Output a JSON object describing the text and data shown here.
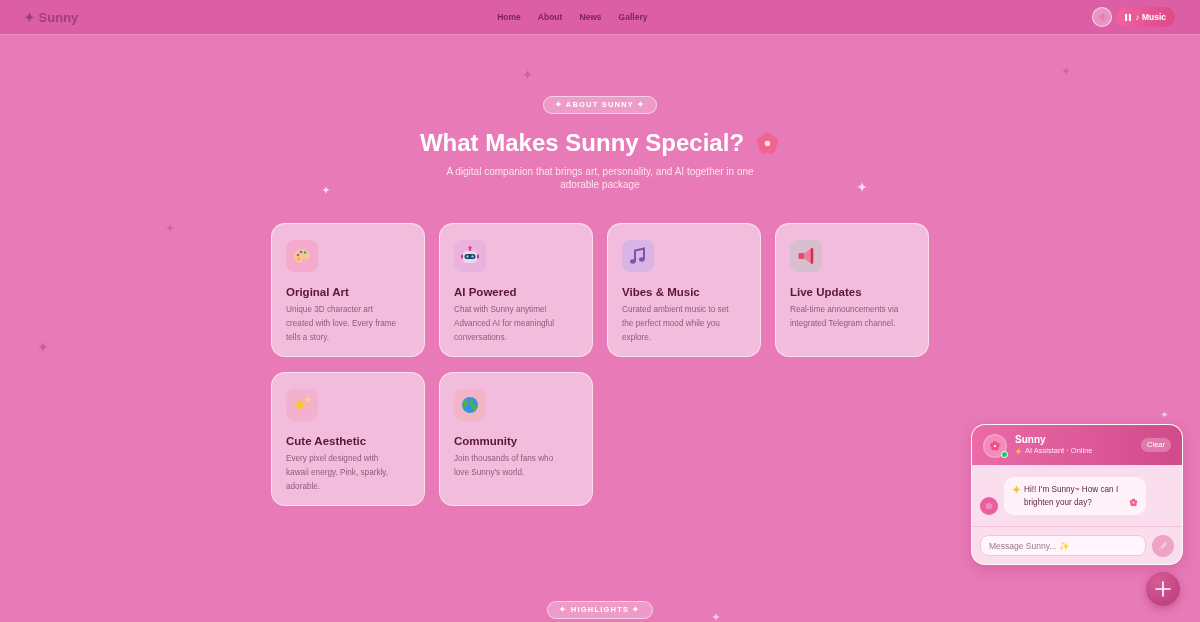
{
  "header": {
    "logo": "✦ Sunny",
    "nav": [
      "Home",
      "About",
      "News",
      "Gallery"
    ],
    "music_button": {
      "label": "♪ Music",
      "playing": true
    }
  },
  "about": {
    "badge": "✦ ABOUT SUNNY ✦",
    "title": "What Makes Sunny Special?",
    "subtitle": "A digital companion that brings art, personality, and AI together in one adorable package"
  },
  "features": [
    {
      "kind": "palette",
      "title": "Original Art",
      "description": "Unique 3D character art created with love. Every frame tells a story."
    },
    {
      "kind": "robot",
      "title": "AI Powered",
      "description": "Chat with Sunny anytime! Advanced AI for meaningful conversations."
    },
    {
      "kind": "music",
      "title": "Vibes & Music",
      "description": "Curated ambient music to set the perfect mood while you explore."
    },
    {
      "kind": "megaphone",
      "title": "Live Updates",
      "description": "Real-time announcements via integrated Telegram channel."
    },
    {
      "kind": "sparkles",
      "title": "Cute Aesthetic",
      "description": "Every pixel designed with kawaii energy. Pink, sparkly, adorable."
    },
    {
      "kind": "globe",
      "title": "Community",
      "description": "Join thousands of fans who love Sunny's world."
    }
  ],
  "highlights_badge": "✦ HIGHLIGHTS ✦",
  "chat": {
    "name": "Sunny",
    "status": "AI Assistant · Online",
    "online": true,
    "clear_button": "Clear",
    "messages": [
      {
        "kind": "bot",
        "text": "Hi!! I'm Sunny~ How can I brighten your day?"
      }
    ],
    "input": {
      "placeholder": "Message Sunny... ✨"
    }
  }
}
